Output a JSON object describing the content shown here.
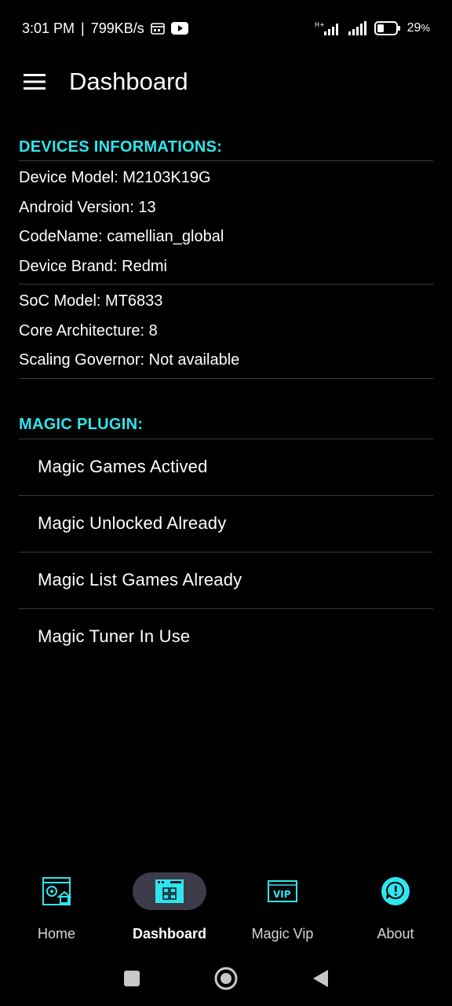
{
  "status_bar": {
    "time": "3:01 PM",
    "separator": "|",
    "net_speed": "799KB/s",
    "battery": "29",
    "battery_unit": "%",
    "icons": [
      "calendar-icon",
      "youtube-icon",
      "signal-hplus-icon",
      "signal-icon",
      "battery-icon"
    ]
  },
  "app_bar": {
    "title": "Dashboard",
    "menu_icon": "hamburger-menu-icon"
  },
  "device_info": {
    "title": "DEVICES INFORMATIONS:",
    "group1": [
      "Device Model: M2103K19G",
      "Android Version: 13",
      "CodeName: camellian_global",
      "Device Brand: Redmi"
    ],
    "group2": [
      "SoC Model: MT6833",
      "Core Architecture: 8",
      "Scaling Governor: Not available"
    ]
  },
  "magic_plugin": {
    "title": "MAGIC PLUGIN:",
    "items": [
      "Magic Games Actived",
      "Magic Unlocked Already",
      "Magic List Games Already",
      "Magic Tuner In Use"
    ]
  },
  "bottom_nav": {
    "items": [
      {
        "label": "Home",
        "icon": "home-gear-icon",
        "active": false
      },
      {
        "label": "Dashboard",
        "icon": "dashboard-window-icon",
        "active": true
      },
      {
        "label": "Magic Vip",
        "icon": "vip-icon",
        "active": false
      },
      {
        "label": "About",
        "icon": "chat-info-icon",
        "active": false
      }
    ]
  },
  "colors": {
    "accent": "#2ee6ee",
    "background": "#000000",
    "active_pill": "#3b3b4a",
    "divider": "#3a3a3a"
  }
}
